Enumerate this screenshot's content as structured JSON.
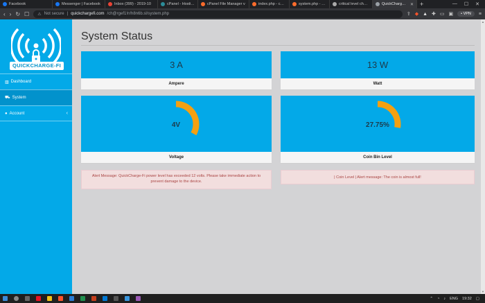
{
  "browser": {
    "tabs": [
      {
        "label": "Facebook",
        "color": "#1877f2"
      },
      {
        "label": "Messenger | Facebook",
        "color": "#1877f2"
      },
      {
        "label": "Inbox (399) - 2019-10",
        "color": "#ea4335"
      },
      {
        "label": "cPanel - Hosting",
        "color": "#2c8c99"
      },
      {
        "label": "cPanel File Manager v",
        "color": "#ff6c2c"
      },
      {
        "label": "index.php - cPanel Fil",
        "color": "#ff6c2c"
      },
      {
        "label": "system.php - cPanel F",
        "color": "#ff6c2c"
      },
      {
        "label": "critical level chart htm",
        "color": "#aaaaaa"
      },
      {
        "label": "QuickCharge-Fi D",
        "color": "#9aa0a6",
        "active": true
      }
    ],
    "new_tab": "+",
    "security": "Not secure",
    "url_host": "quickchargefi.com",
    "url_path": "/ch@rgef1!n!h8n6b.sl/system.php",
    "vpn_label": "• VPN"
  },
  "sidebar": {
    "brand": "QUICKCHARGE-FI",
    "items": [
      {
        "label": "Dashboard",
        "icon": "chart-icon"
      },
      {
        "label": "System",
        "icon": "car-icon",
        "active": true
      },
      {
        "label": "Account",
        "icon": "user-icon",
        "chevron": "‹"
      }
    ]
  },
  "main": {
    "title": "System Status",
    "cards": {
      "ampere": {
        "value": "3 A",
        "label": "Ampere"
      },
      "watt": {
        "value": "13 W",
        "label": "Watt"
      },
      "voltage": {
        "value": "4V",
        "label": "Voltage",
        "gauge_fraction": 0.33
      },
      "coin": {
        "value": "27.75%",
        "label": "Coin Bin Level",
        "gauge_fraction": 0.2775
      }
    },
    "alerts": {
      "voltage": "Alert Message: QuickCharge-Fi power level has exceeded 12 volts. Please take immediate action to prevent damage to the device.",
      "coin": "| Coin Level | Alert message: The coin is almost full!"
    }
  },
  "taskbar": {
    "lang": "ENG",
    "time": "19:32"
  },
  "colors": {
    "accent": "#03a9e8",
    "gauge": "#f4a011",
    "alert_bg": "#f2dede",
    "alert_text": "#a94442"
  }
}
